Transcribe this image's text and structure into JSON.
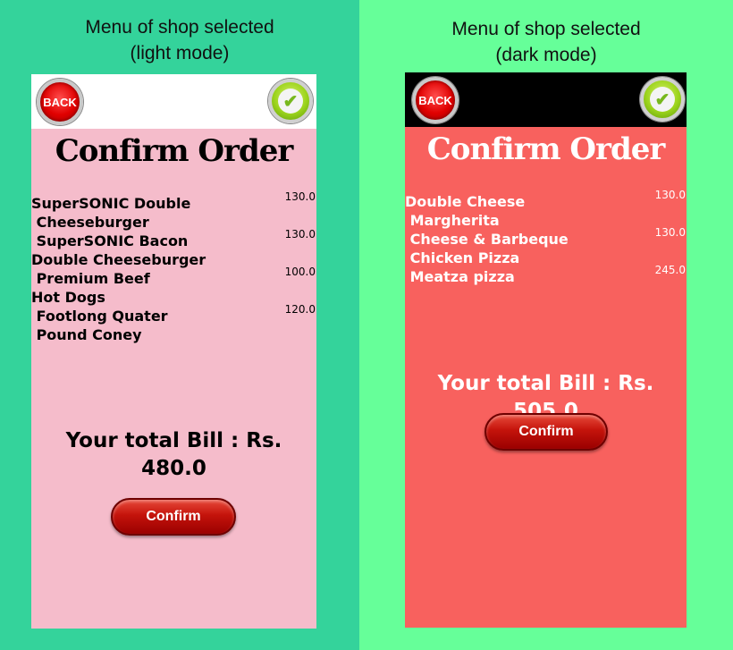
{
  "light": {
    "caption_line1": "Menu of shop selected",
    "caption_line2": "(light mode)",
    "back_label": "BACK",
    "check_icon": "✔",
    "title": "Confirm Order",
    "items": [
      {
        "name": "SuperSONIC Double\n Cheeseburger",
        "price": "130.0"
      },
      {
        "name": " SuperSONIC Bacon\nDouble Cheeseburger",
        "price": "130.0"
      },
      {
        "name": " Premium Beef\nHot Dogs",
        "price": "100.0"
      },
      {
        "name": " Footlong Quater\n Pound Coney",
        "price": "120.0"
      }
    ],
    "total_line1": "Your total Bill : Rs.",
    "total_line2": "480.0",
    "confirm_label": "Confirm",
    "colors": {
      "outer": "#34d39b",
      "appbar": "#ffffff",
      "body": "#f5bccb",
      "text": "#000000"
    }
  },
  "dark": {
    "caption_line1": "Menu of shop selected",
    "caption_line2": "(dark mode)",
    "back_label": "BACK",
    "check_icon": "✔",
    "title": "Confirm Order",
    "items": [
      {
        "name": "Double Cheese\n Margherita",
        "price": "130.0"
      },
      {
        "name": " Cheese & Barbeque\n Chicken Pizza",
        "price": "130.0"
      },
      {
        "name": " Meatza pizza",
        "price": "245.0"
      }
    ],
    "total_line1": "Your total Bill : Rs. 505.0",
    "confirm_label": "Confirm",
    "colors": {
      "outer": "#66ff99",
      "appbar": "#000000",
      "body": "#f8615e",
      "text": "#ffffff"
    }
  }
}
